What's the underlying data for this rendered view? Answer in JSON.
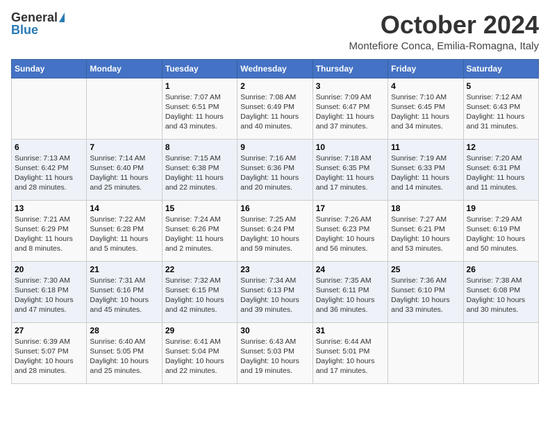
{
  "header": {
    "logo_general": "General",
    "logo_blue": "Blue",
    "month_title": "October 2024",
    "location": "Montefiore Conca, Emilia-Romagna, Italy"
  },
  "calendar": {
    "days_of_week": [
      "Sunday",
      "Monday",
      "Tuesday",
      "Wednesday",
      "Thursday",
      "Friday",
      "Saturday"
    ],
    "weeks": [
      [
        {
          "day": "",
          "detail": ""
        },
        {
          "day": "",
          "detail": ""
        },
        {
          "day": "1",
          "detail": "Sunrise: 7:07 AM\nSunset: 6:51 PM\nDaylight: 11 hours and 43 minutes."
        },
        {
          "day": "2",
          "detail": "Sunrise: 7:08 AM\nSunset: 6:49 PM\nDaylight: 11 hours and 40 minutes."
        },
        {
          "day": "3",
          "detail": "Sunrise: 7:09 AM\nSunset: 6:47 PM\nDaylight: 11 hours and 37 minutes."
        },
        {
          "day": "4",
          "detail": "Sunrise: 7:10 AM\nSunset: 6:45 PM\nDaylight: 11 hours and 34 minutes."
        },
        {
          "day": "5",
          "detail": "Sunrise: 7:12 AM\nSunset: 6:43 PM\nDaylight: 11 hours and 31 minutes."
        }
      ],
      [
        {
          "day": "6",
          "detail": "Sunrise: 7:13 AM\nSunset: 6:42 PM\nDaylight: 11 hours and 28 minutes."
        },
        {
          "day": "7",
          "detail": "Sunrise: 7:14 AM\nSunset: 6:40 PM\nDaylight: 11 hours and 25 minutes."
        },
        {
          "day": "8",
          "detail": "Sunrise: 7:15 AM\nSunset: 6:38 PM\nDaylight: 11 hours and 22 minutes."
        },
        {
          "day": "9",
          "detail": "Sunrise: 7:16 AM\nSunset: 6:36 PM\nDaylight: 11 hours and 20 minutes."
        },
        {
          "day": "10",
          "detail": "Sunrise: 7:18 AM\nSunset: 6:35 PM\nDaylight: 11 hours and 17 minutes."
        },
        {
          "day": "11",
          "detail": "Sunrise: 7:19 AM\nSunset: 6:33 PM\nDaylight: 11 hours and 14 minutes."
        },
        {
          "day": "12",
          "detail": "Sunrise: 7:20 AM\nSunset: 6:31 PM\nDaylight: 11 hours and 11 minutes."
        }
      ],
      [
        {
          "day": "13",
          "detail": "Sunrise: 7:21 AM\nSunset: 6:29 PM\nDaylight: 11 hours and 8 minutes."
        },
        {
          "day": "14",
          "detail": "Sunrise: 7:22 AM\nSunset: 6:28 PM\nDaylight: 11 hours and 5 minutes."
        },
        {
          "day": "15",
          "detail": "Sunrise: 7:24 AM\nSunset: 6:26 PM\nDaylight: 11 hours and 2 minutes."
        },
        {
          "day": "16",
          "detail": "Sunrise: 7:25 AM\nSunset: 6:24 PM\nDaylight: 10 hours and 59 minutes."
        },
        {
          "day": "17",
          "detail": "Sunrise: 7:26 AM\nSunset: 6:23 PM\nDaylight: 10 hours and 56 minutes."
        },
        {
          "day": "18",
          "detail": "Sunrise: 7:27 AM\nSunset: 6:21 PM\nDaylight: 10 hours and 53 minutes."
        },
        {
          "day": "19",
          "detail": "Sunrise: 7:29 AM\nSunset: 6:19 PM\nDaylight: 10 hours and 50 minutes."
        }
      ],
      [
        {
          "day": "20",
          "detail": "Sunrise: 7:30 AM\nSunset: 6:18 PM\nDaylight: 10 hours and 47 minutes."
        },
        {
          "day": "21",
          "detail": "Sunrise: 7:31 AM\nSunset: 6:16 PM\nDaylight: 10 hours and 45 minutes."
        },
        {
          "day": "22",
          "detail": "Sunrise: 7:32 AM\nSunset: 6:15 PM\nDaylight: 10 hours and 42 minutes."
        },
        {
          "day": "23",
          "detail": "Sunrise: 7:34 AM\nSunset: 6:13 PM\nDaylight: 10 hours and 39 minutes."
        },
        {
          "day": "24",
          "detail": "Sunrise: 7:35 AM\nSunset: 6:11 PM\nDaylight: 10 hours and 36 minutes."
        },
        {
          "day": "25",
          "detail": "Sunrise: 7:36 AM\nSunset: 6:10 PM\nDaylight: 10 hours and 33 minutes."
        },
        {
          "day": "26",
          "detail": "Sunrise: 7:38 AM\nSunset: 6:08 PM\nDaylight: 10 hours and 30 minutes."
        }
      ],
      [
        {
          "day": "27",
          "detail": "Sunrise: 6:39 AM\nSunset: 5:07 PM\nDaylight: 10 hours and 28 minutes."
        },
        {
          "day": "28",
          "detail": "Sunrise: 6:40 AM\nSunset: 5:05 PM\nDaylight: 10 hours and 25 minutes."
        },
        {
          "day": "29",
          "detail": "Sunrise: 6:41 AM\nSunset: 5:04 PM\nDaylight: 10 hours and 22 minutes."
        },
        {
          "day": "30",
          "detail": "Sunrise: 6:43 AM\nSunset: 5:03 PM\nDaylight: 10 hours and 19 minutes."
        },
        {
          "day": "31",
          "detail": "Sunrise: 6:44 AM\nSunset: 5:01 PM\nDaylight: 10 hours and 17 minutes."
        },
        {
          "day": "",
          "detail": ""
        },
        {
          "day": "",
          "detail": ""
        }
      ]
    ]
  }
}
